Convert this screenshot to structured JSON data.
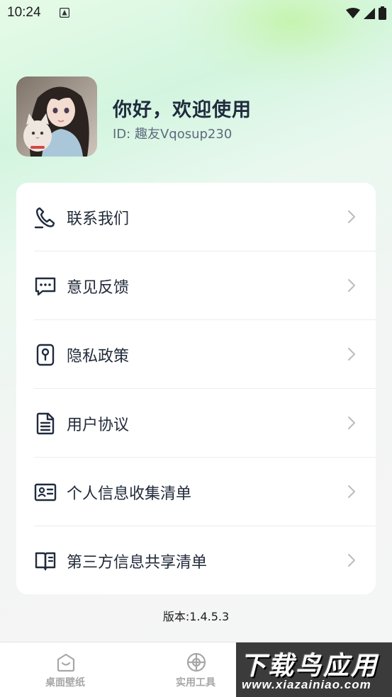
{
  "status_bar": {
    "time": "10:24",
    "icons": [
      "notification-icon",
      "wifi-icon",
      "signal-icon",
      "battery-icon"
    ]
  },
  "profile": {
    "greeting": "你好，欢迎使用",
    "user_id": "ID: 趣友Vqosup230"
  },
  "menu": {
    "items": [
      {
        "label": "联系我们",
        "icon": "phone-icon"
      },
      {
        "label": "意见反馈",
        "icon": "chat-icon"
      },
      {
        "label": "隐私政策",
        "icon": "lock-icon"
      },
      {
        "label": "用户协议",
        "icon": "document-icon"
      },
      {
        "label": "个人信息收集清单",
        "icon": "id-card-icon"
      },
      {
        "label": "第三方信息共享清单",
        "icon": "book-icon"
      }
    ]
  },
  "footer": {
    "version": "版本:1.4.5.3"
  },
  "bottom_nav": {
    "items": [
      {
        "label": "桌面壁纸",
        "icon": "wallpaper-icon"
      },
      {
        "label": "实用工具",
        "icon": "tools-icon"
      }
    ]
  },
  "watermark": {
    "title": "下载鸟应用",
    "url": "www.xiazainiao.com"
  },
  "colors": {
    "text_primary": "#1f2b3e",
    "text_secondary": "#5d6a7e",
    "nav_inactive": "#a7a7a7",
    "card_bg": "#ffffff"
  }
}
